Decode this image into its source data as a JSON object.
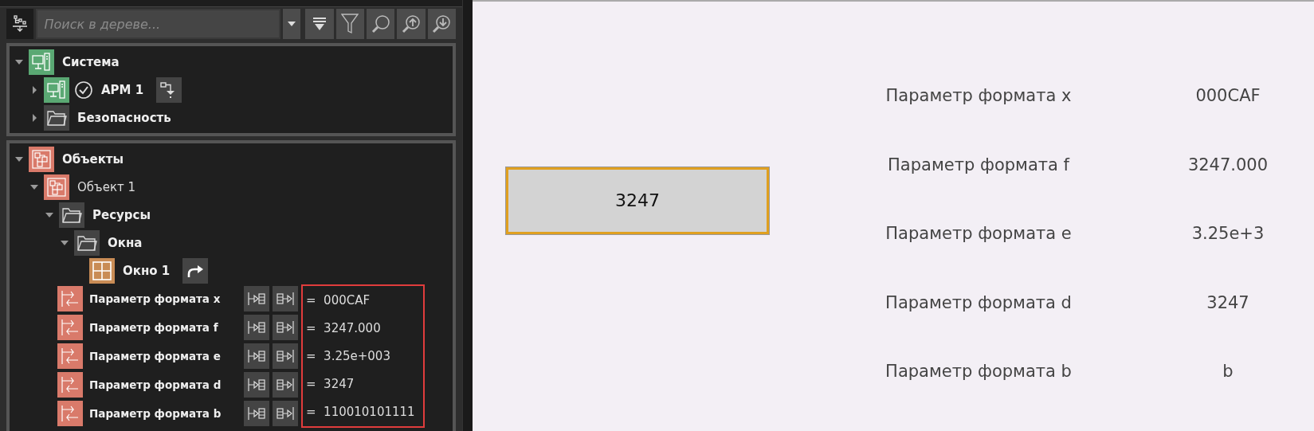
{
  "toolbar": {
    "search": {
      "placeholder": "Поиск в дереве..."
    }
  },
  "tree": [
    {
      "label": "Система",
      "kind": "system",
      "expanded": true,
      "bold": true,
      "children": [
        {
          "label": "АРМ 1",
          "kind": "workstation",
          "expanded": false,
          "bold": true,
          "online": true,
          "actions": [
            {
              "kind": "deploy"
            }
          ]
        },
        {
          "label": "Безопасность",
          "kind": "folder",
          "expanded": false,
          "bold": true
        }
      ]
    },
    {
      "label": "Объекты",
      "kind": "objects",
      "expanded": true,
      "bold": true,
      "children": [
        {
          "label": "Объект 1",
          "kind": "object",
          "expanded": true,
          "bold": false,
          "values_highlighted": true,
          "children": [
            {
              "label": "Ресурсы",
              "kind": "folder",
              "expanded": true,
              "bold": true,
              "children": [
                {
                  "label": "Окна",
                  "kind": "folder",
                  "expanded": true,
                  "bold": true,
                  "children": [
                    {
                      "label": "Окно 1",
                      "kind": "window",
                      "bold": true,
                      "actions": [
                        {
                          "kind": "link"
                        }
                      ]
                    }
                  ]
                }
              ]
            }
          ],
          "parameters": [
            {
              "label": "Параметр формата x",
              "value": "=  000CAF",
              "actions": [
                {
                  "kind": "read"
                },
                {
                  "kind": "write"
                }
              ]
            },
            {
              "label": "Параметр формата f",
              "value": "=  3247.000",
              "actions": [
                {
                  "kind": "read"
                },
                {
                  "kind": "write"
                }
              ]
            },
            {
              "label": "Параметр формата e",
              "value": "=  3.25e+003",
              "actions": [
                {
                  "kind": "read"
                },
                {
                  "kind": "write"
                }
              ]
            },
            {
              "label": "Параметр формата d",
              "value": "=  3247",
              "actions": [
                {
                  "kind": "read"
                },
                {
                  "kind": "write"
                }
              ]
            },
            {
              "label": "Параметр формата b",
              "value": "=  110010101111",
              "actions": [
                {
                  "kind": "read"
                },
                {
                  "kind": "write"
                }
              ]
            }
          ]
        }
      ]
    }
  ],
  "display": {
    "button": {
      "label": "3247",
      "focused": true
    },
    "rows": [
      {
        "label": "Параметр формата x",
        "value": "000CAF"
      },
      {
        "label": "Параметр формата f",
        "value": "3247.000"
      },
      {
        "label": "Параметр формата e",
        "value": "3.25e+3"
      },
      {
        "label": "Параметр формата d",
        "value": "3247"
      },
      {
        "label": "Параметр формата b",
        "value": "b"
      }
    ]
  }
}
